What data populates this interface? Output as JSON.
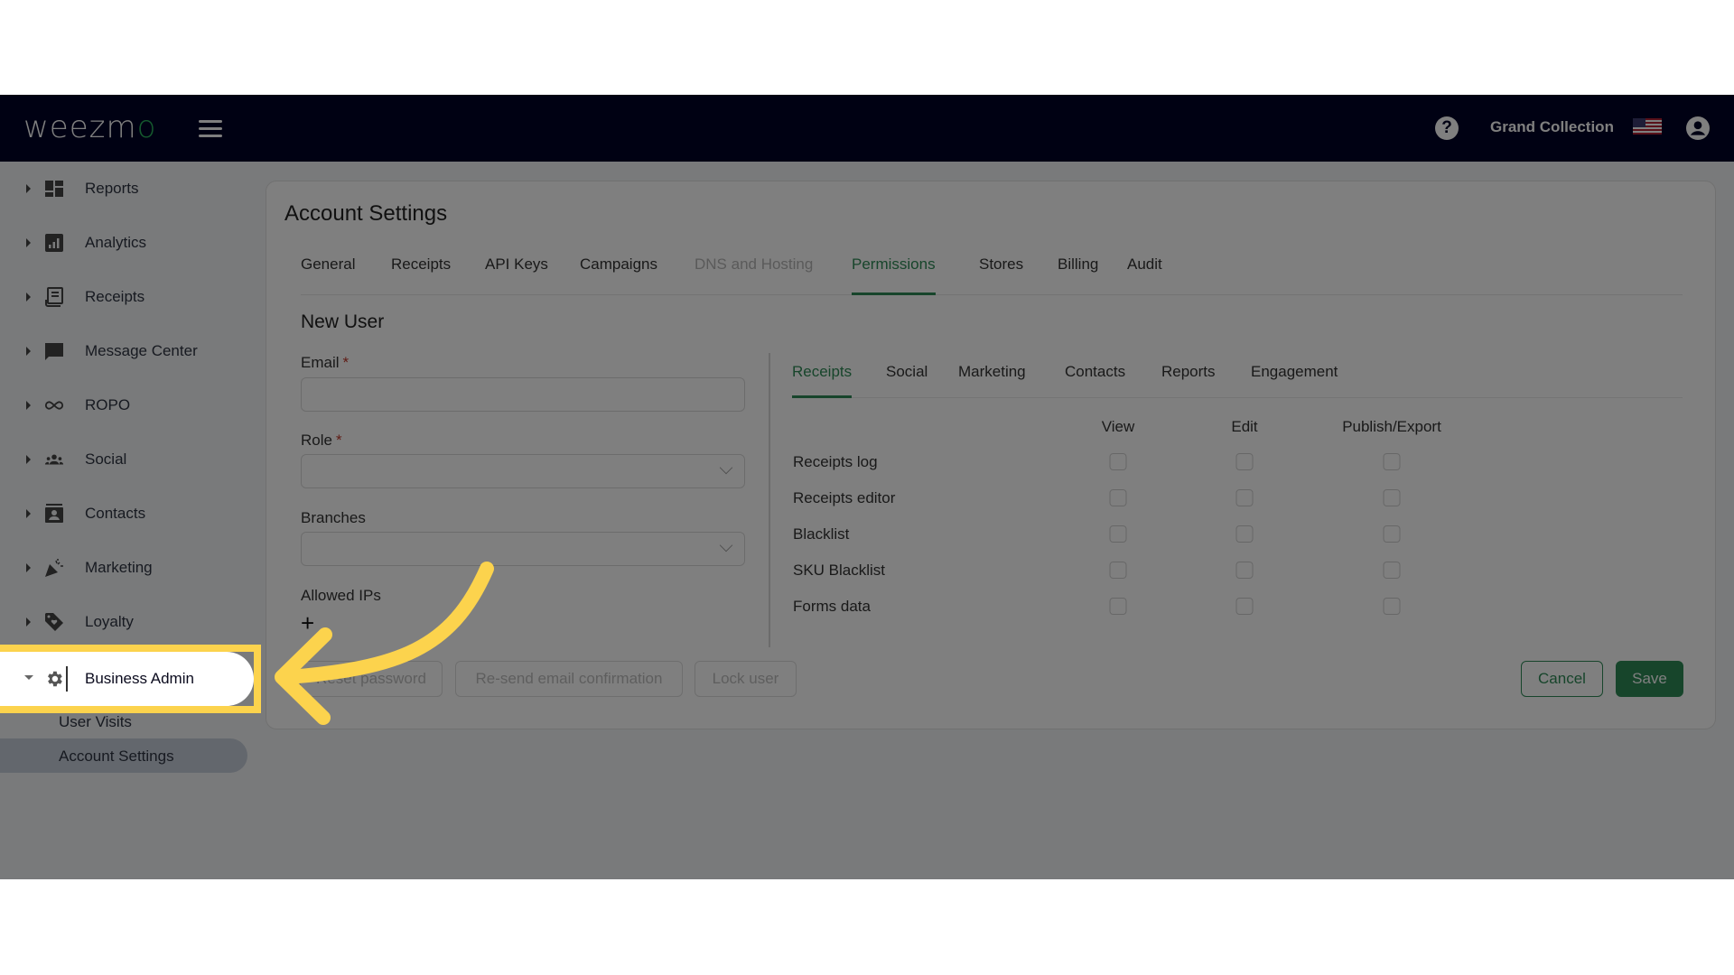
{
  "header": {
    "logo_text": "weezm",
    "logo_accent": "o",
    "account_name": "Grand Collection",
    "icons": [
      "menu-icon",
      "help-icon",
      "us-flag-icon",
      "user-account-icon"
    ]
  },
  "sidebar": {
    "items": [
      {
        "label": "Reports",
        "icon": "dashboard-icon"
      },
      {
        "label": "Analytics",
        "icon": "bar-chart-icon"
      },
      {
        "label": "Receipts",
        "icon": "receipt-icon"
      },
      {
        "label": "Message Center",
        "icon": "chat-icon"
      },
      {
        "label": "ROPO",
        "icon": "infinity-icon"
      },
      {
        "label": "Social",
        "icon": "people-icon"
      },
      {
        "label": "Contacts",
        "icon": "contact-card-icon"
      },
      {
        "label": "Marketing",
        "icon": "party-popper-icon"
      },
      {
        "label": "Loyalty",
        "icon": "tag-heart-icon"
      },
      {
        "label": "Business Admin",
        "icon": "gear-icon",
        "expanded": true
      }
    ],
    "sub_items": [
      {
        "label": "User Visits",
        "selected": false
      },
      {
        "label": "Account Settings",
        "selected": true
      }
    ]
  },
  "page": {
    "title": "Account Settings",
    "tabs": [
      {
        "label": "General"
      },
      {
        "label": "Receipts"
      },
      {
        "label": "API Keys"
      },
      {
        "label": "Campaigns"
      },
      {
        "label": "DNS and Hosting",
        "disabled": true
      },
      {
        "label": "Permissions",
        "active": true
      },
      {
        "label": "Stores"
      },
      {
        "label": "Billing"
      },
      {
        "label": "Audit"
      }
    ]
  },
  "form": {
    "section_title": "New User",
    "email_label": "Email",
    "email_value": "",
    "role_label": "Role",
    "role_value": "",
    "branches_label": "Branches",
    "branches_value": "",
    "required_mark": "*",
    "allowed_ips_label": "Allowed IPs",
    "add_ip_symbol": "+"
  },
  "permissions": {
    "tabs": [
      {
        "label": "Receipts",
        "active": true
      },
      {
        "label": "Social"
      },
      {
        "label": "Marketing"
      },
      {
        "label": "Contacts"
      },
      {
        "label": "Reports"
      },
      {
        "label": "Engagement"
      }
    ],
    "columns": [
      "View",
      "Edit",
      "Publish/Export"
    ],
    "rows": [
      {
        "label": "Receipts log",
        "view": false,
        "edit": false,
        "publish": false
      },
      {
        "label": "Receipts editor",
        "view": false,
        "edit": false,
        "publish": false
      },
      {
        "label": "Blacklist",
        "view": false,
        "edit": false,
        "publish": false
      },
      {
        "label": "SKU Blacklist",
        "view": false,
        "edit": false,
        "publish": false
      },
      {
        "label": "Forms data",
        "view": false,
        "edit": false,
        "publish": false
      }
    ]
  },
  "actions": {
    "reset_password": "Reset password",
    "resend_confirmation": "Re-send email confirmation",
    "lock_user": "Lock user",
    "cancel": "Cancel",
    "save": "Save"
  },
  "annotation": {
    "highlighted_item": "Business Admin",
    "highlight_color": "#fcd34d",
    "arrow_color": "#fcd34d"
  },
  "colors": {
    "header_bg": "#010326",
    "accent": "#2e8b57",
    "required": "#c0392b"
  }
}
